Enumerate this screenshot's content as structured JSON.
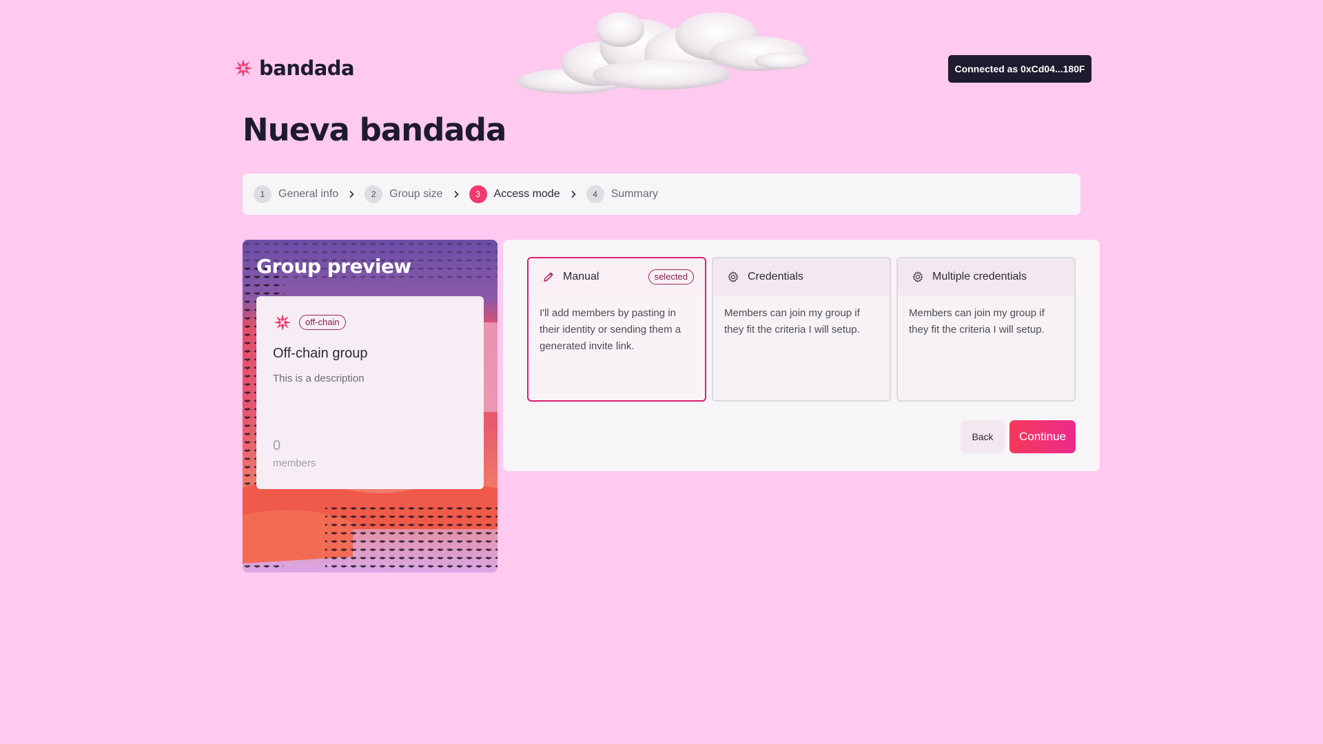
{
  "app": {
    "logo_text": "bandada",
    "connected_label": "Connected as 0xCd04...180F"
  },
  "page": {
    "title": "Nueva bandada"
  },
  "stepper": {
    "steps": [
      {
        "num": "1",
        "label": "General info",
        "state": "done"
      },
      {
        "num": "2",
        "label": "Group size",
        "state": "done"
      },
      {
        "num": "3",
        "label": "Access mode",
        "state": "active"
      },
      {
        "num": "4",
        "label": "Summary",
        "state": "pending"
      }
    ]
  },
  "preview": {
    "title": "Group preview",
    "badge": "off-chain",
    "group_name": "Off-chain group",
    "description": "This is a description",
    "member_count": "0",
    "member_label": "members"
  },
  "access_modes": {
    "options": [
      {
        "title": "Manual",
        "icon": "pencil-icon",
        "selected": true,
        "badge": "selected",
        "description": "I'll add members by pasting in their identity or sending them a generated invite link."
      },
      {
        "title": "Credentials",
        "icon": "gear-icon",
        "selected": false,
        "description": "Members can join my group if they fit the criteria I will setup."
      },
      {
        "title": "Multiple credentials",
        "icon": "gear-icon",
        "selected": false,
        "description": "Members can join my group if they fit the criteria I will setup."
      }
    ],
    "back_label": "Back",
    "continue_label": "Continue"
  },
  "colors": {
    "background": "#ffc9f0",
    "accent": "#f23a6f",
    "dark": "#1e1b2e"
  }
}
